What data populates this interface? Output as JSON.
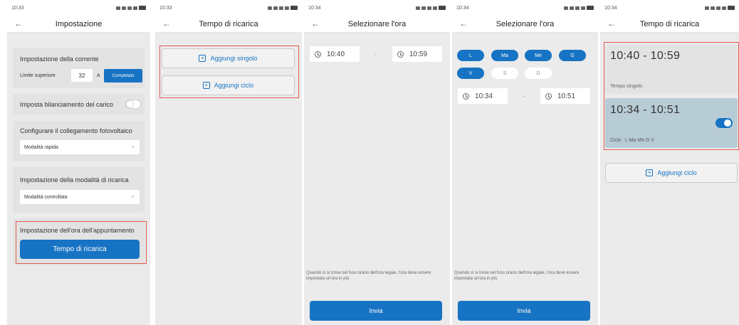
{
  "status_times": [
    "10:33",
    "10:33",
    "10:34",
    "10:34",
    "10:34"
  ],
  "screen1": {
    "title": "Impostazione",
    "current_section_title": "Impostazione della corrente",
    "upper_limit_label": "Limite superiore",
    "upper_limit_value": "32",
    "unit": "A",
    "completed_button": "Completato",
    "load_balance_label": "Imposta bilanciamento del carico",
    "load_balance_enabled": false,
    "pv_section_title": "Configurare il collegamento fotovoltaico",
    "pv_selected": "Modalità rapida",
    "charge_mode_title": "Impostazione della modalità di ricarica",
    "charge_mode_selected": "Modalità controllata",
    "appointment_title": "Impostazione dell'ora dell'appuntamento",
    "charge_time_button": "Tempo di ricarica"
  },
  "screen2": {
    "title": "Tempo di ricarica",
    "add_single": "Aggiungi singolo",
    "add_cycle": "Aggiungi ciclo"
  },
  "screen3": {
    "title": "Selezionare l'ora",
    "start_time": "10:40",
    "separator": "-",
    "end_time": "10:59",
    "note": "Quando ci si trova nel fuso orario dell'ora legale, l'ora deve essere impostata un'ora in più",
    "submit": "Invia"
  },
  "screen4": {
    "title": "Selezionare l'ora",
    "days": [
      {
        "label": "L",
        "selected": true
      },
      {
        "label": "Ma",
        "selected": true
      },
      {
        "label": "Me",
        "selected": true
      },
      {
        "label": "G",
        "selected": true
      },
      {
        "label": "V",
        "selected": true
      },
      {
        "label": "S",
        "selected": false
      },
      {
        "label": "D",
        "selected": false
      }
    ],
    "start_time": "10:34",
    "separator": "-",
    "end_time": "10:51",
    "note": "Quando ci si trova nel fuso orario dell'ora legale, l'ora deve essere impostata un'ora in più",
    "submit": "Invia"
  },
  "screen5": {
    "title": "Tempo di ricarica",
    "entries": [
      {
        "time_range": "10:40 - 10:59",
        "type_label": "Tempo singolo"
      },
      {
        "time_range": "10:34 - 10:51",
        "type_label": "Ciclo",
        "days_label": "L Ma Me G V",
        "enabled": true
      }
    ],
    "add_cycle": "Aggiungi ciclo"
  },
  "colors": {
    "accent": "#1773c3",
    "highlight_border": "#e05a4f",
    "panel_bg": "#ebebeb",
    "card_bg": "#e3e3e3",
    "active_card_bg": "#b8ccd6"
  }
}
